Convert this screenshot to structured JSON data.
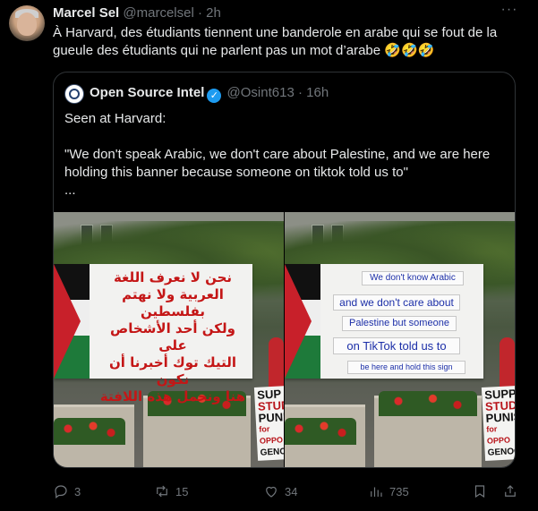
{
  "tweet": {
    "author_name": "Marcel Sel",
    "author_handle": "@marcelsel",
    "separator": "·",
    "time": "2h",
    "text": "À Harvard, des étudiants tiennent une banderole en arabe qui se fout de la gueule des étudiants qui ne parlent pas un mot d’arabe 🤣🤣🤣"
  },
  "quoted": {
    "author_name": "Open Source Intel",
    "author_handle": "@Osint613",
    "separator": "·",
    "time": "16h",
    "line1": "Seen at Harvard:",
    "line2": "\"We don't speak Arabic, we don't care about Palestine, and we are here holding this banner because someone on tiktok told us to\"",
    "line3": "...",
    "media": {
      "left": {
        "arabic_lines": [
          "نحن لا نعرف اللغة",
          "العربية ولا نهتم بفلسطين",
          "ولكن أحد الأشخاص على",
          "التيك توك أخبرنا أن نكون",
          "هنا ونحمل هذه اللافتة"
        ],
        "sign_lines": [
          "SUP",
          "STUDE",
          "PUNISH",
          "for OPPO",
          "GENOC"
        ]
      },
      "right": {
        "english_lines": [
          "We don't know Arabic",
          "and we don't care about",
          "Palestine but someone",
          "on TikTok told us to",
          "be here and hold this sign"
        ],
        "sign_lines": [
          "SUPP",
          "STUDE",
          "PUNISH",
          "for OPPO",
          "GENOC"
        ]
      }
    }
  },
  "actions": {
    "replies": "3",
    "reposts": "15",
    "likes": "34",
    "views": "735"
  },
  "icons": [
    "more-icon",
    "verified-icon",
    "reply-icon",
    "repost-icon",
    "like-icon",
    "views-icon",
    "bookmark-icon",
    "share-icon"
  ],
  "colors": {
    "background": "#000000",
    "text": "#e7e9ea",
    "muted": "#71767b",
    "accent": "#1d9bf0",
    "border": "#2f3336"
  }
}
